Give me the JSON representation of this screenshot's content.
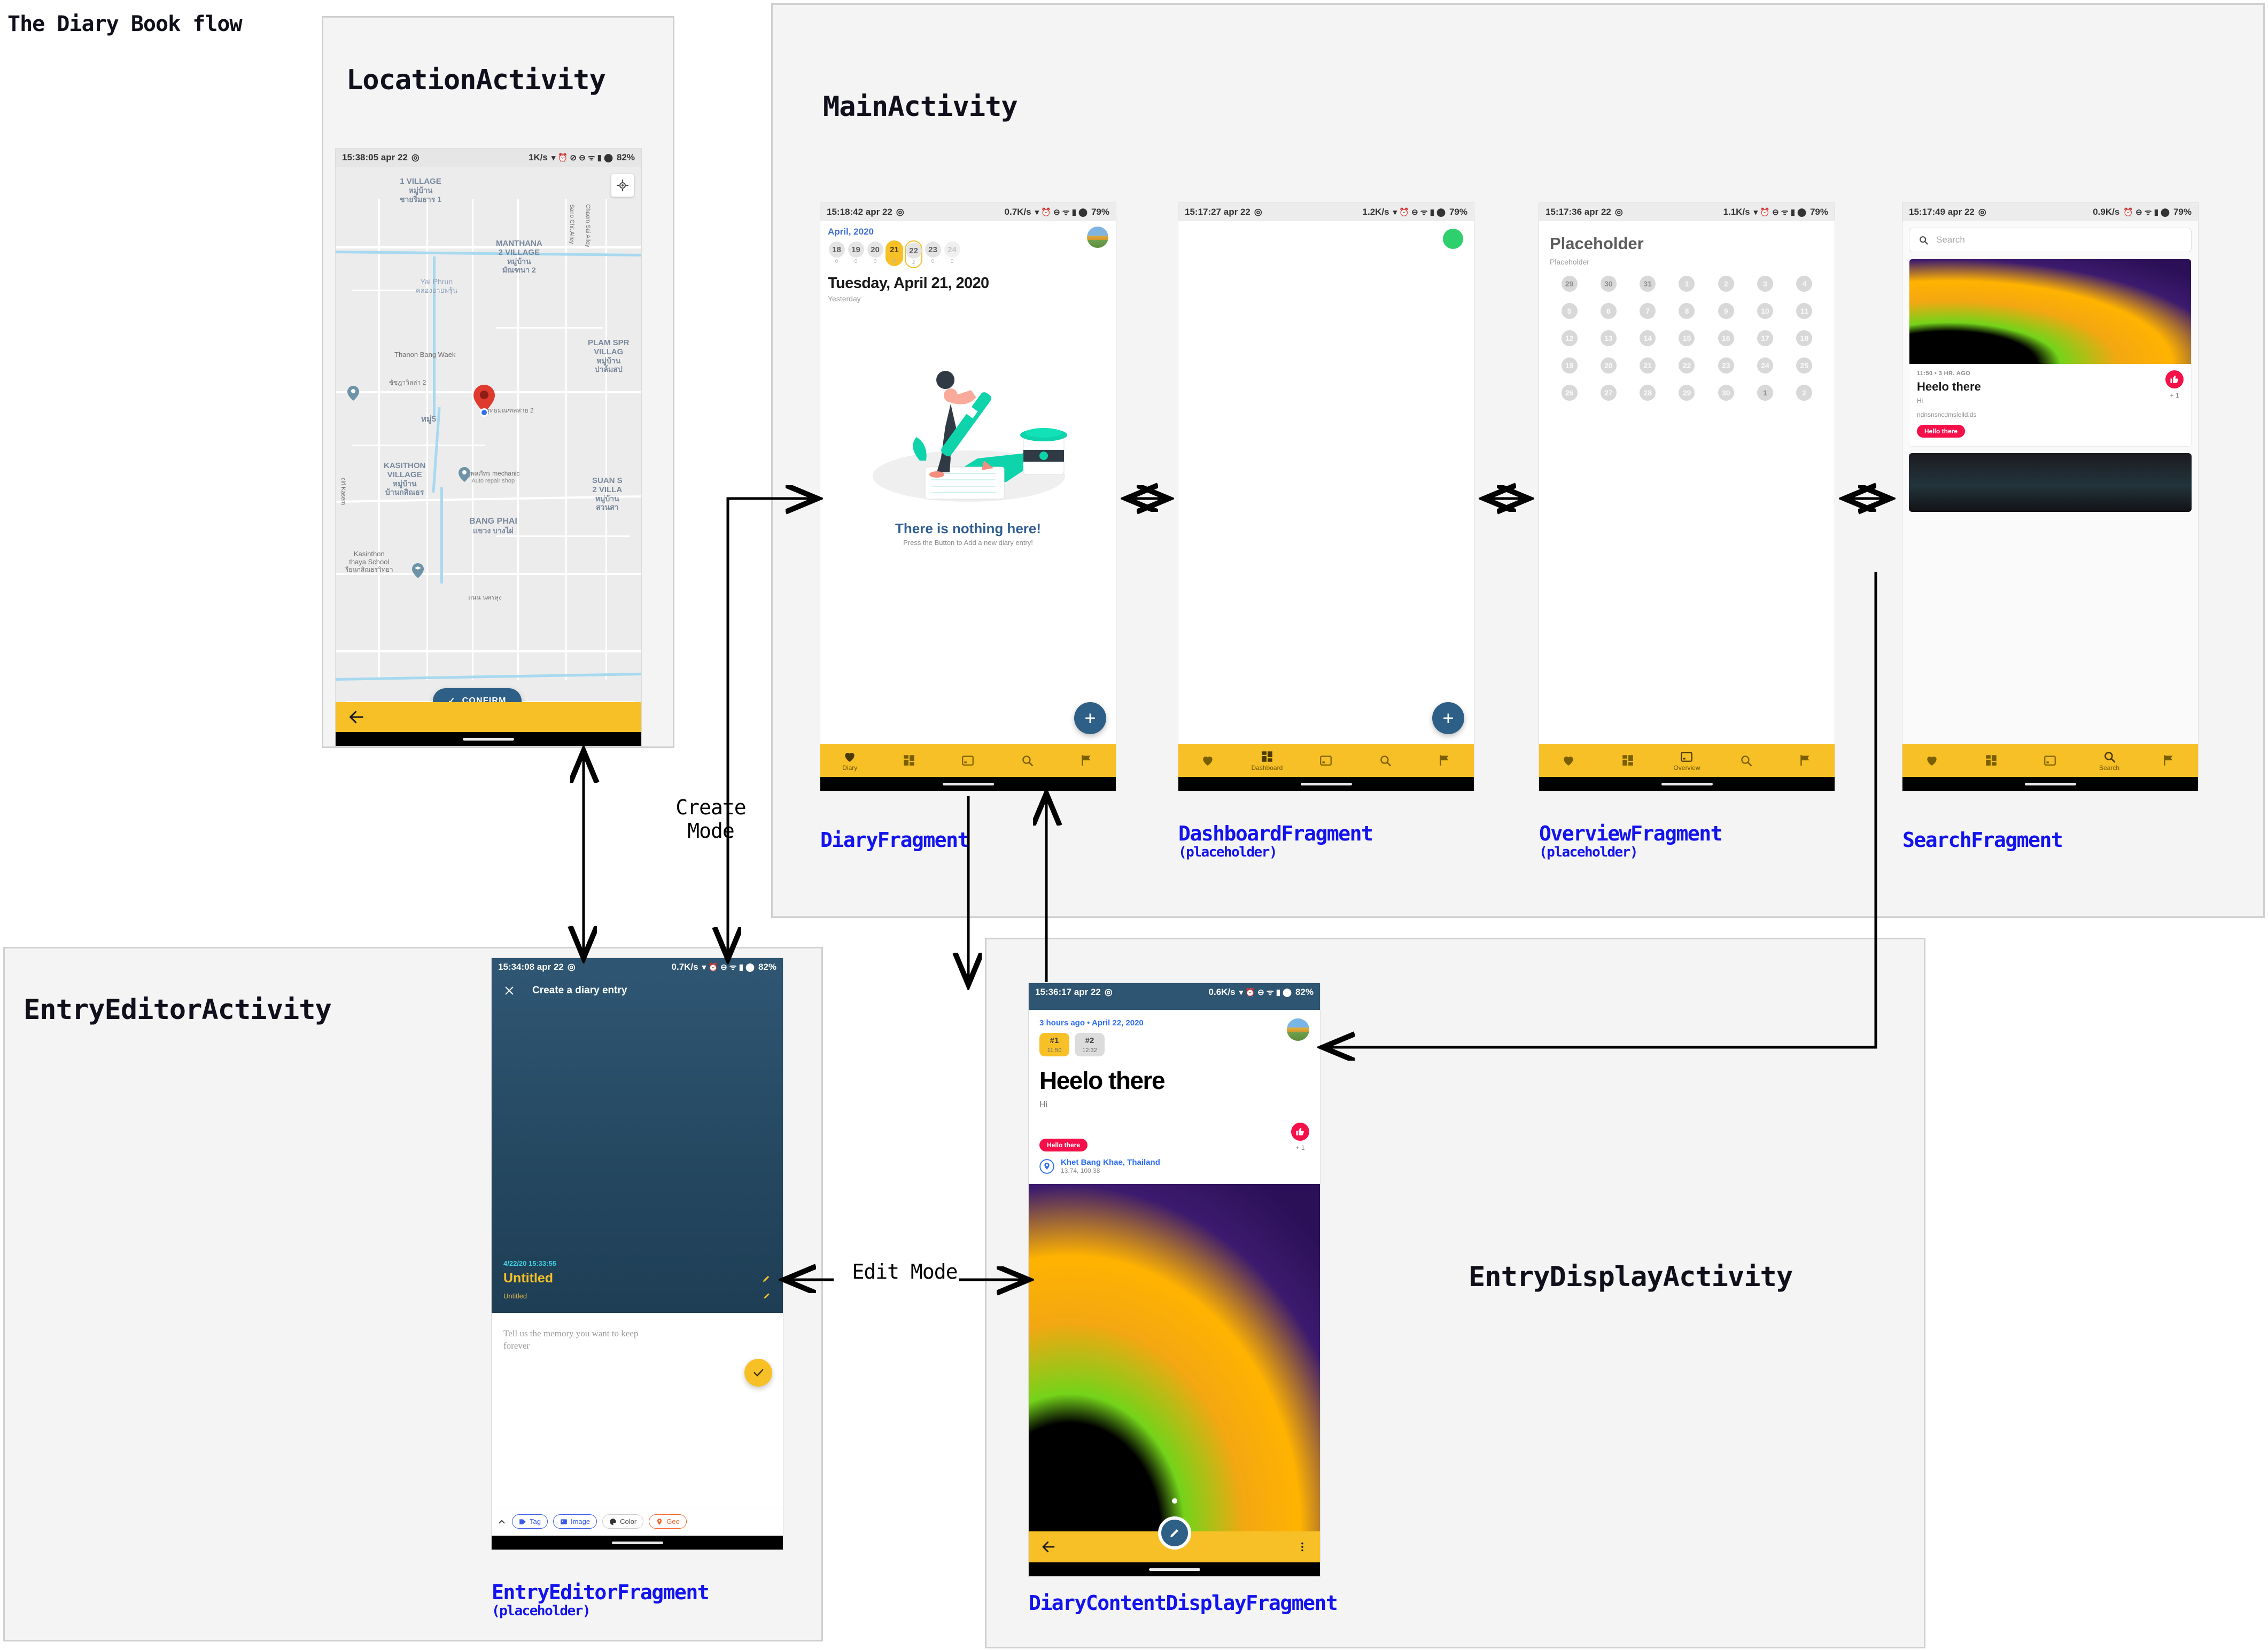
{
  "diagram": {
    "title": "The Diary Book flow",
    "mode_labels": {
      "create": "Create\nMode",
      "create_line1": "Create",
      "create_line2": "Mode",
      "edit": "Edit Mode"
    }
  },
  "activities": {
    "location": {
      "title": "LocationActivity"
    },
    "main": {
      "title": "MainActivity"
    },
    "entry_editor": {
      "title": "EntryEditorActivity"
    },
    "entry_display": {
      "title": "EntryDisplayActivity"
    }
  },
  "fragment_labels": {
    "diary": {
      "name": "DiaryFragment",
      "sub": ""
    },
    "dashboard": {
      "name": "DashboardFragment",
      "sub": "(placeholder)"
    },
    "overview": {
      "name": "OverviewFragment",
      "sub": "(placeholder)"
    },
    "search": {
      "name": "SearchFragment",
      "sub": ""
    },
    "entry_editor": {
      "name": "EntryEditorFragment",
      "sub": "(placeholder)"
    },
    "diary_content_display": {
      "name": "DiaryContentDisplayFragment",
      "sub": ""
    }
  },
  "screens": {
    "location": {
      "status": {
        "time": "15:38:05 apr 22",
        "net": "1K/s",
        "battery": "82%"
      },
      "map_labels": [
        {
          "text": "1 VILLAGE",
          "sub": "หมู่บ้าน",
          "sub2": "ชายริ่มธาร 1"
        },
        {
          "text": "MANTHANA",
          "sub": "2 VILLAGE",
          "sub2": "หมู่บ้าน",
          "sub3": "มัณฑนา 2"
        },
        {
          "text": "Yai Phrun",
          "sub": "คลองยายพรุ้น"
        },
        {
          "text": "Thanon Bang Waek"
        },
        {
          "text": "PLAM SPR",
          "sub": "VILLAG",
          "sub2": "หมู่บ้าน",
          "sub3": "ปาล์มสป"
        },
        {
          "text": "KASITHON",
          "sub": "VILLAGE",
          "sub2": "หมู่บ้าน",
          "sub3": "บ้านกสิณธร"
        },
        {
          "text": "SUAN S",
          "sub": "2 VILLA",
          "sub2": "หมู่บ้าน",
          "sub3": "สวนสา"
        },
        {
          "text": "BANG PHAI",
          "sub": "แขวง บางไผ่"
        },
        {
          "text": "Kasinthon",
          "sub": "thaya School",
          "sub2": "รียนกสิณธรวิทยา"
        },
        {
          "text": "อู่พลภัทร mechanic",
          "sub": "Auto repair shop"
        },
        {
          "text": "ซัซฎาวิลล่า 2"
        },
        {
          "text": "หมู่5"
        },
        {
          "text": "พุทธมณฑลสาย 2"
        },
        {
          "text": "ถนน นครลุง"
        },
        {
          "text": "Sano Chit Alley"
        },
        {
          "text": "Chaem Sai Alley"
        },
        {
          "text": "ciri Kasem"
        }
      ],
      "confirm_label": "CONFIRM",
      "gps_icon": "my-location-icon",
      "back_icon": "back-arrow-icon"
    },
    "diary": {
      "status": {
        "time": "15:18:42 apr 22",
        "net": "0.7K/s",
        "battery": "79%"
      },
      "month": "April, 2020",
      "days": [
        {
          "n": "18",
          "dot": "0",
          "state": "normal"
        },
        {
          "n": "19",
          "dot": "0",
          "state": "normal"
        },
        {
          "n": "20",
          "dot": "0",
          "state": "normal"
        },
        {
          "n": "21",
          "dot": "0",
          "state": "selected"
        },
        {
          "n": "22",
          "dot": "2",
          "state": "today"
        },
        {
          "n": "23",
          "dot": "0",
          "state": "normal"
        },
        {
          "n": "24",
          "dot": "0",
          "state": "dim"
        }
      ],
      "headline": "Tuesday, April 21, 2020",
      "subhead": "Yesterday",
      "empty_title": "There is nothing here!",
      "empty_sub": "Press the Button to Add a new diary entry!",
      "fab_label": "+",
      "nav": [
        {
          "icon": "heart-icon",
          "label": "Diary",
          "active": true
        },
        {
          "icon": "dashboard-icon",
          "label": "",
          "active": false
        },
        {
          "icon": "calendar-icon",
          "label": "",
          "active": false
        },
        {
          "icon": "search-icon",
          "label": "",
          "active": false
        },
        {
          "icon": "flag-icon",
          "label": "",
          "active": false
        }
      ]
    },
    "dashboard": {
      "status": {
        "time": "15:17:27 apr 22",
        "net": "1.2K/s",
        "battery": "79%"
      },
      "fab_label": "+",
      "nav": [
        {
          "icon": "heart-icon",
          "label": "",
          "active": false
        },
        {
          "icon": "dashboard-icon",
          "label": "Dashboard",
          "active": true
        },
        {
          "icon": "calendar-icon",
          "label": "",
          "active": false
        },
        {
          "icon": "search-icon",
          "label": "",
          "active": false
        },
        {
          "icon": "flag-icon",
          "label": "",
          "active": false
        }
      ]
    },
    "overview": {
      "status": {
        "time": "15:17:36 apr 22",
        "net": "1.1K/s",
        "battery": "79%"
      },
      "title": "Placeholder",
      "subtitle": "Placeholder",
      "calendar_rows": [
        [
          "29",
          "30",
          "31",
          "1",
          "2",
          "3",
          "4"
        ],
        [
          "5",
          "6",
          "7",
          "8",
          "9",
          "10",
          "11"
        ],
        [
          "12",
          "13",
          "14",
          "15",
          "16",
          "17",
          "18"
        ],
        [
          "19",
          "20",
          "21",
          "22",
          "23",
          "24",
          "25"
        ],
        [
          "26",
          "27",
          "28",
          "29",
          "30",
          "1",
          "2"
        ]
      ],
      "nav": [
        {
          "icon": "heart-icon",
          "label": "",
          "active": false
        },
        {
          "icon": "dashboard-icon",
          "label": "",
          "active": false
        },
        {
          "icon": "calendar-icon",
          "label": "Overview",
          "active": true
        },
        {
          "icon": "search-icon",
          "label": "",
          "active": false
        },
        {
          "icon": "flag-icon",
          "label": "",
          "active": false
        }
      ]
    },
    "search": {
      "status": {
        "time": "15:17:49 apr 22",
        "net": "0.9K/s",
        "battery": "79%"
      },
      "search_placeholder": "Search",
      "result": {
        "time_meta": "11:50 • 3 HR. AGO",
        "title": "Heelo there",
        "body": "Hi",
        "extra": "ndnsnsncdmslelld.ds",
        "chip": "Hello there",
        "like_count": "+ 1"
      },
      "nav": [
        {
          "icon": "heart-icon",
          "label": "",
          "active": false
        },
        {
          "icon": "dashboard-icon",
          "label": "",
          "active": false
        },
        {
          "icon": "calendar-icon",
          "label": "",
          "active": false
        },
        {
          "icon": "search-icon",
          "label": "Search",
          "active": true
        },
        {
          "icon": "flag-icon",
          "label": "",
          "active": false
        }
      ]
    },
    "entry_editor": {
      "status": {
        "time": "15:34:08 apr 22",
        "net": "0.7K/s",
        "battery": "82%"
      },
      "toolbar_title": "Create a diary entry",
      "close_icon": "close-icon",
      "timestamp": "4/22/20 15:33:55",
      "title_value": "Untitled",
      "subtitle_value": "Untitled",
      "edit_icon": "pencil-icon",
      "body_placeholder": "Tell us the memory you want to keep forever",
      "save_icon": "check-icon",
      "chips": [
        {
          "label": "Tag",
          "icon": "tag-icon",
          "style": "blue"
        },
        {
          "label": "Image",
          "icon": "image-icon",
          "style": "blue"
        },
        {
          "label": "Color",
          "icon": "palette-icon",
          "style": "plain"
        },
        {
          "label": "Geo",
          "icon": "location-pin-icon",
          "style": "orange"
        }
      ],
      "expand_icon": "chevron-up-icon"
    },
    "entry_display": {
      "status": {
        "time": "15:36:17 apr 22",
        "net": "0.6K/s",
        "battery": "82%"
      },
      "meta": "3 hours ago • April 22, 2020",
      "tags": [
        {
          "label": "#1",
          "time": "11:50",
          "active": true
        },
        {
          "label": "#2",
          "time": "12:32",
          "active": false
        }
      ],
      "title": "Heelo there",
      "body": "Hi",
      "chip": "Hello there",
      "like_count": "+ 1",
      "geo_name": "Khet Bang Khae, Thailand",
      "geo_coord": "13.74, 100.38",
      "back_icon": "back-arrow-icon",
      "more_icon": "overflow-menu-icon",
      "edit_fab_icon": "pencil-icon"
    }
  },
  "colors": {
    "accent_yellow": "#f6c026",
    "accent_blue": "#2e5f86",
    "accent_red": "#f5104a",
    "label_blue": "#1313ee"
  }
}
